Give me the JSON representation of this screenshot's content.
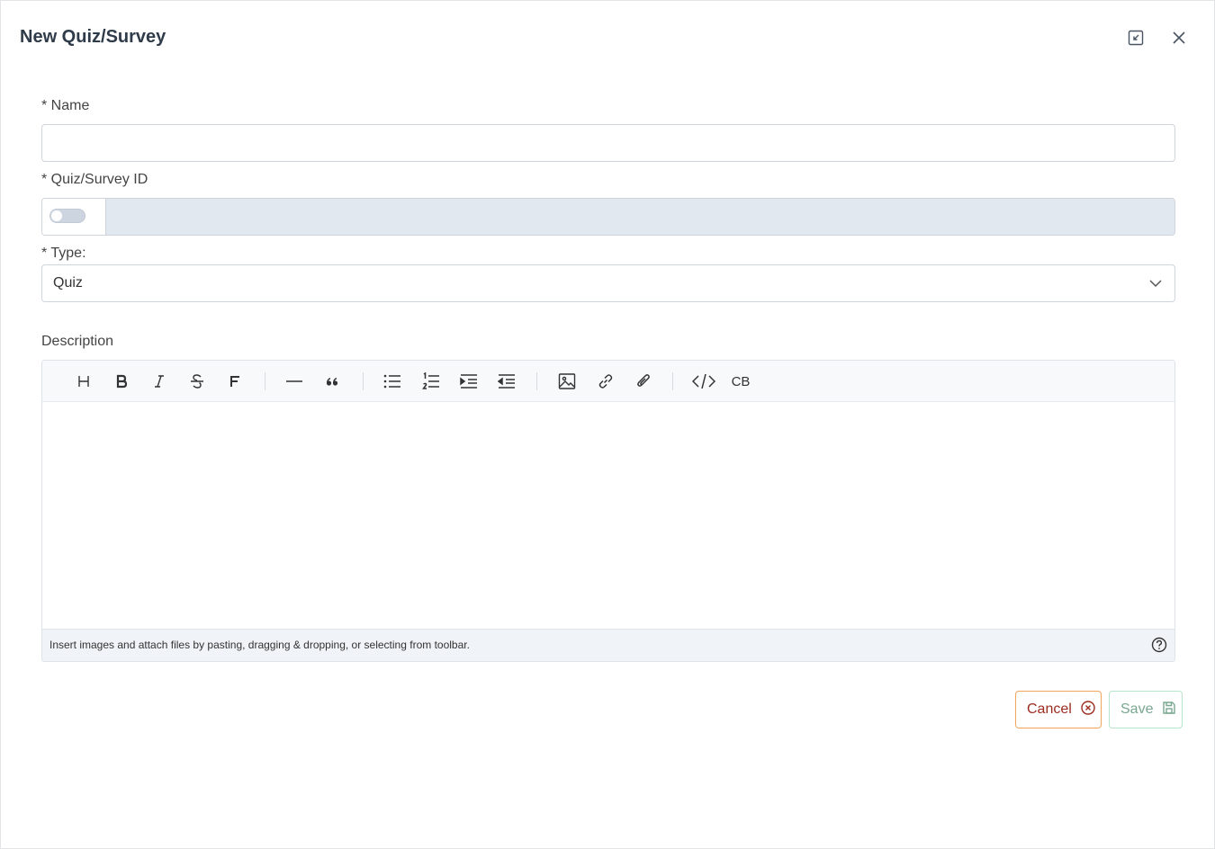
{
  "dialog": {
    "title": "New Quiz/Survey"
  },
  "form": {
    "name_label": "* Name",
    "name_value": "",
    "id_label": "* Quiz/Survey ID",
    "id_value": "",
    "type_label": "* Type:",
    "type_value": "Quiz",
    "description_label": "Description"
  },
  "editor": {
    "toolbar": [
      "heading",
      "bold",
      "italic",
      "strikethrough",
      "font",
      "horizontal-rule",
      "quote",
      "bullet-list",
      "numbered-list",
      "indent",
      "outdent",
      "image",
      "link",
      "attachment",
      "code",
      "code-block"
    ],
    "code_block_glyph": "CB",
    "hint": "Insert images and attach files by pasting, dragging & dropping, or selecting from toolbar."
  },
  "actions": {
    "cancel_label": "Cancel",
    "save_label": "Save"
  },
  "colors": {
    "cancel_border": "#f0a55a",
    "cancel_text": "#9b2c1f",
    "save_border": "#b7e4cd",
    "save_text": "#7aa890",
    "readonly_field": "#e2e8f0"
  }
}
